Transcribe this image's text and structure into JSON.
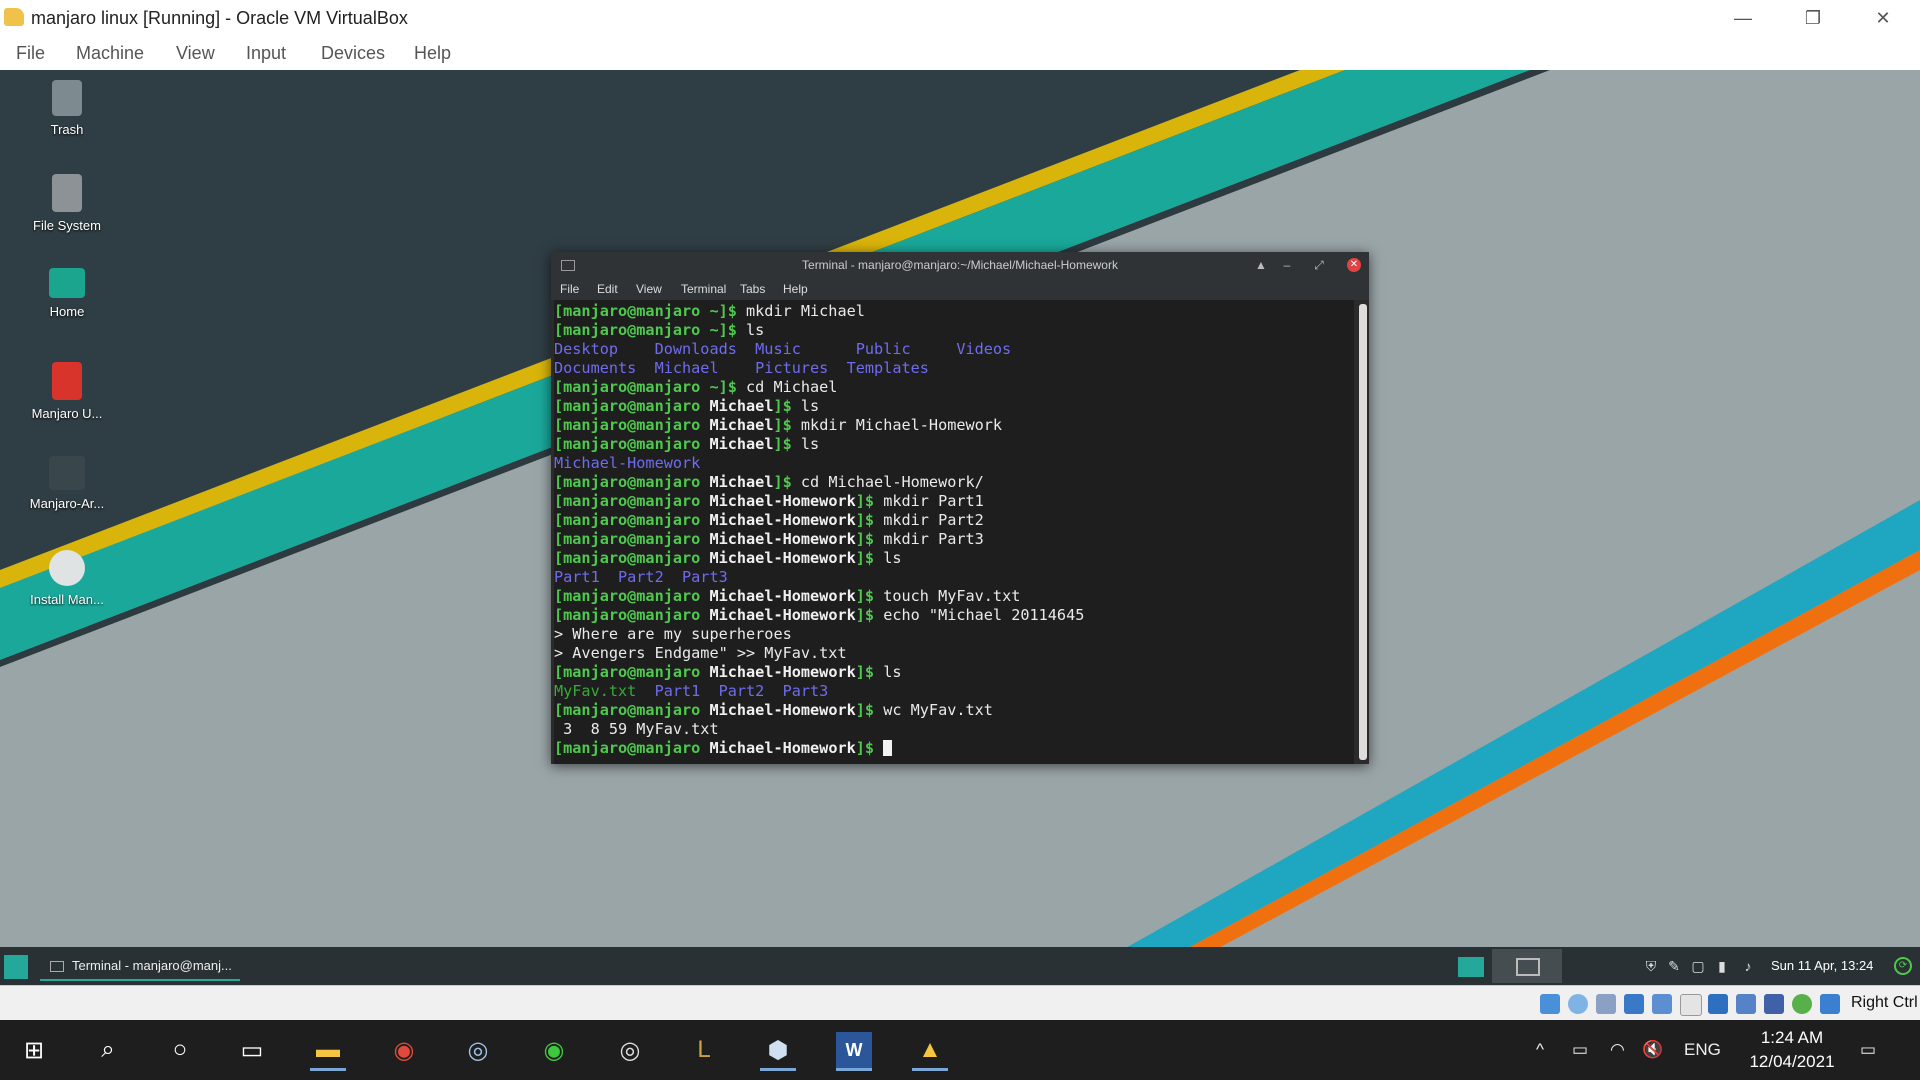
{
  "host_window": {
    "title": "manjaro linux [Running] - Oracle VM VirtualBox",
    "menu": [
      "File",
      "Machine",
      "View",
      "Input",
      "Devices",
      "Help"
    ],
    "controls": {
      "minimize": "—",
      "restore": "❐",
      "close": "✕"
    }
  },
  "desktop_icons": [
    {
      "label": "Trash",
      "icon": "trash-icon"
    },
    {
      "label": "File System",
      "icon": "drive-icon"
    },
    {
      "label": "Home",
      "icon": "home-folder-icon"
    },
    {
      "label": "Manjaro U...",
      "icon": "pdf-icon"
    },
    {
      "label": "Manjaro-Ar...",
      "icon": "terminal-download-icon"
    },
    {
      "label": "Install Man...",
      "icon": "install-disc-icon"
    }
  ],
  "terminal": {
    "title": "Terminal - manjaro@manjaro:~/Michael/Michael-Homework",
    "menu": [
      "File",
      "Edit",
      "View",
      "Terminal",
      "Tabs",
      "Help"
    ],
    "lines": {
      "l1_prompt": "[manjaro@manjaro ~]$",
      "l1_cmd": " mkdir Michael",
      "l2_prompt": "[manjaro@manjaro ~]$",
      "l2_cmd": " ls",
      "l3": "Desktop    Downloads  Music      Public     Videos",
      "l4": "Documents  Michael    Pictures  Templates",
      "l5_prompt": "[manjaro@manjaro ~]$",
      "l5_cmd": " cd Michael",
      "l6_prompt_a": "[manjaro@manjaro ",
      "l6_dir": "Michael",
      "l6_prompt_b": "]$",
      "l6_cmd": " ls",
      "l7_prompt_a": "[manjaro@manjaro ",
      "l7_dir": "Michael",
      "l7_prompt_b": "]$",
      "l7_cmd": " mkdir Michael-Homework",
      "l8_prompt_a": "[manjaro@manjaro ",
      "l8_dir": "Michael",
      "l8_prompt_b": "]$",
      "l8_cmd": " ls",
      "l9": "Michael-Homework",
      "l10_prompt_a": "[manjaro@manjaro ",
      "l10_dir": "Michael",
      "l10_prompt_b": "]$",
      "l10_cmd": " cd Michael-Homework/",
      "l11_prompt_a": "[manjaro@manjaro ",
      "l11_dir": "Michael-Homework",
      "l11_prompt_b": "]$",
      "l11_cmd": " mkdir Part1",
      "l12_prompt_a": "[manjaro@manjaro ",
      "l12_dir": "Michael-Homework",
      "l12_prompt_b": "]$",
      "l12_cmd": " mkdir Part2",
      "l13_prompt_a": "[manjaro@manjaro ",
      "l13_dir": "Michael-Homework",
      "l13_prompt_b": "]$",
      "l13_cmd": " mkdir Part3",
      "l14_prompt_a": "[manjaro@manjaro ",
      "l14_dir": "Michael-Homework",
      "l14_prompt_b": "]$",
      "l14_cmd": " ls",
      "l15": "Part1  Part2  Part3",
      "l16_prompt_a": "[manjaro@manjaro ",
      "l16_dir": "Michael-Homework",
      "l16_prompt_b": "]$",
      "l16_cmd": " touch MyFav.txt",
      "l17_prompt_a": "[manjaro@manjaro ",
      "l17_dir": "Michael-Homework",
      "l17_prompt_b": "]$",
      "l17_cmd": " echo \"Michael 20114645",
      "l18": "> Where are my superheroes",
      "l19": "> Avengers Endgame\" >> MyFav.txt",
      "l20_prompt_a": "[manjaro@manjaro ",
      "l20_dir": "Michael-Homework",
      "l20_prompt_b": "]$",
      "l20_cmd": " ls",
      "l21_file": "MyFav.txt",
      "l21_dirs": "  Part1  Part2  Part3",
      "l22_prompt_a": "[manjaro@manjaro ",
      "l22_dir": "Michael-Homework",
      "l22_prompt_b": "]$",
      "l22_cmd": " wc MyFav.txt",
      "l23": " 3  8 59 MyFav.txt",
      "l24_prompt_a": "[manjaro@manjaro ",
      "l24_dir": "Michael-Homework",
      "l24_prompt_b": "]$"
    }
  },
  "guest_panel": {
    "task_label": "Terminal - manjaro@manj...",
    "clock": "Sun 11 Apr, 13:24"
  },
  "vbox_status": {
    "host_key": "Right Ctrl"
  },
  "win_taskbar": {
    "language": "ENG",
    "time": "1:24 AM",
    "date": "12/04/2021"
  }
}
